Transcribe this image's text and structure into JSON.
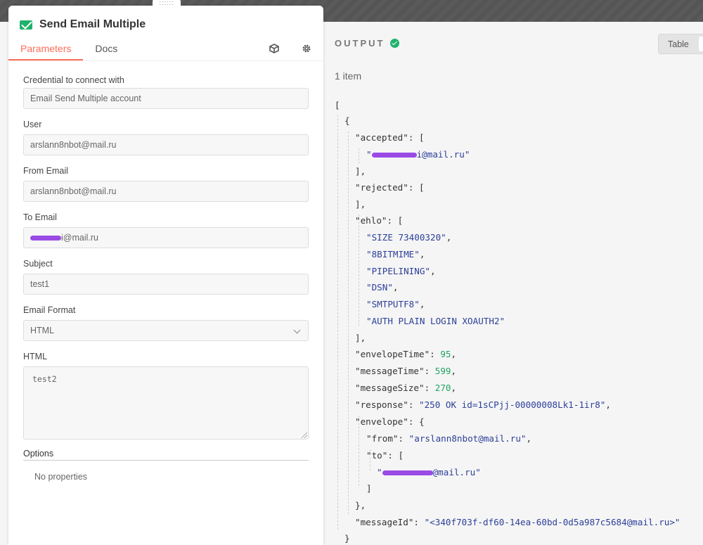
{
  "node": {
    "title": "Send Email Multiple",
    "tabs": [
      "Parameters",
      "Docs"
    ],
    "drag_handle": "::::::"
  },
  "form": {
    "credential_label": "Credential to connect with",
    "credential_value": "Email Send Multiple account",
    "user_label": "User",
    "user_value": "arslann8nbot@mail.ru",
    "from_label": "From Email",
    "from_value": "arslann8nbot@mail.ru",
    "to_label": "To Email",
    "to_value_suffix": "i@mail.ru",
    "subject_label": "Subject",
    "subject_value": "test1",
    "format_label": "Email Format",
    "format_value": "HTML",
    "html_label": "HTML",
    "html_value": "test2",
    "options_label": "Options",
    "options_empty": "No properties"
  },
  "output": {
    "title": "OUTPUT",
    "view_label": "Table",
    "count": "1 item",
    "accepted_suffix": "i@mail.ru\"",
    "ehlo": [
      "\"SIZE 73400320\"",
      "\"8BITMIME\"",
      "\"PIPELINING\"",
      "\"DSN\"",
      "\"SMTPUTF8\"",
      "\"AUTH PLAIN LOGIN XOAUTH2\""
    ],
    "envelopeTime": "95",
    "messageTime": "599",
    "messageSize": "270",
    "response": "\"250 OK id=1sCPjj-00000008Lk1-1ir8\"",
    "from": "\"arslann8nbot@mail.ru\"",
    "to_suffix": "@mail.ru\"",
    "messageId": "\"<340f703f-df60-14ea-60bd-0d5a987c5684@mail.ru>\""
  },
  "colors": {
    "accent": "#ff6d5a",
    "success": "#20b26c",
    "string": "#2c3f99",
    "number": "#21a363"
  },
  "icons": [
    "envelope-icon",
    "cube-icon",
    "gear-icon",
    "check-circle-icon",
    "chevron-down-icon"
  ]
}
